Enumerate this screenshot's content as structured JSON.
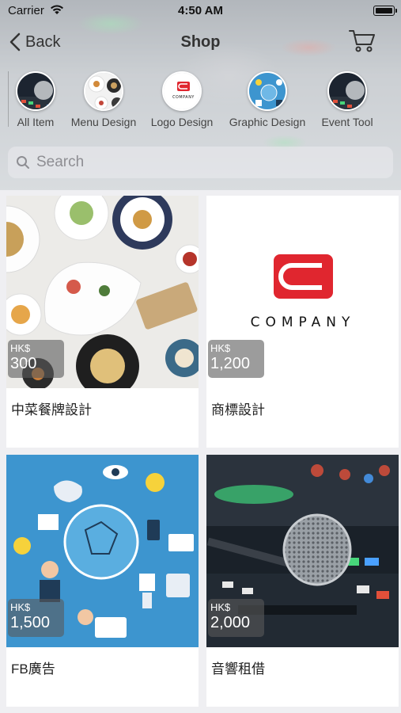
{
  "status_bar": {
    "carrier": "Carrier",
    "time": "4:50 AM"
  },
  "nav": {
    "back_label": "Back",
    "title": "Shop"
  },
  "categories": [
    {
      "label": "All Item",
      "icon": "studio-mixer-thumbnail"
    },
    {
      "label": "Menu Design",
      "icon": "food-plates-thumbnail"
    },
    {
      "label": "Logo Design",
      "icon": "company-logo-thumbnail"
    },
    {
      "label": "Graphic Design",
      "icon": "tech-graphics-thumbnail"
    },
    {
      "label": "Event Tool",
      "icon": "studio-mixer-thumbnail"
    }
  ],
  "search": {
    "placeholder": "Search"
  },
  "products": [
    {
      "name": "中菜餐牌設計",
      "currency": "HK$",
      "price": "300",
      "image": "food-plates"
    },
    {
      "name": "商標設計",
      "currency": "HK$",
      "price": "1,200",
      "image": "company-logo",
      "logo_text": "COMPANY"
    },
    {
      "name": "FB廣告",
      "currency": "HK$",
      "price": "1,500",
      "image": "tech-graphics"
    },
    {
      "name": "音響租借",
      "currency": "HK$",
      "price": "2,000",
      "image": "microphone-mixer"
    }
  ],
  "colors": {
    "logo_red": "#e0262f",
    "graphic_blue": "#3d95cf",
    "background": "#efeff2"
  }
}
